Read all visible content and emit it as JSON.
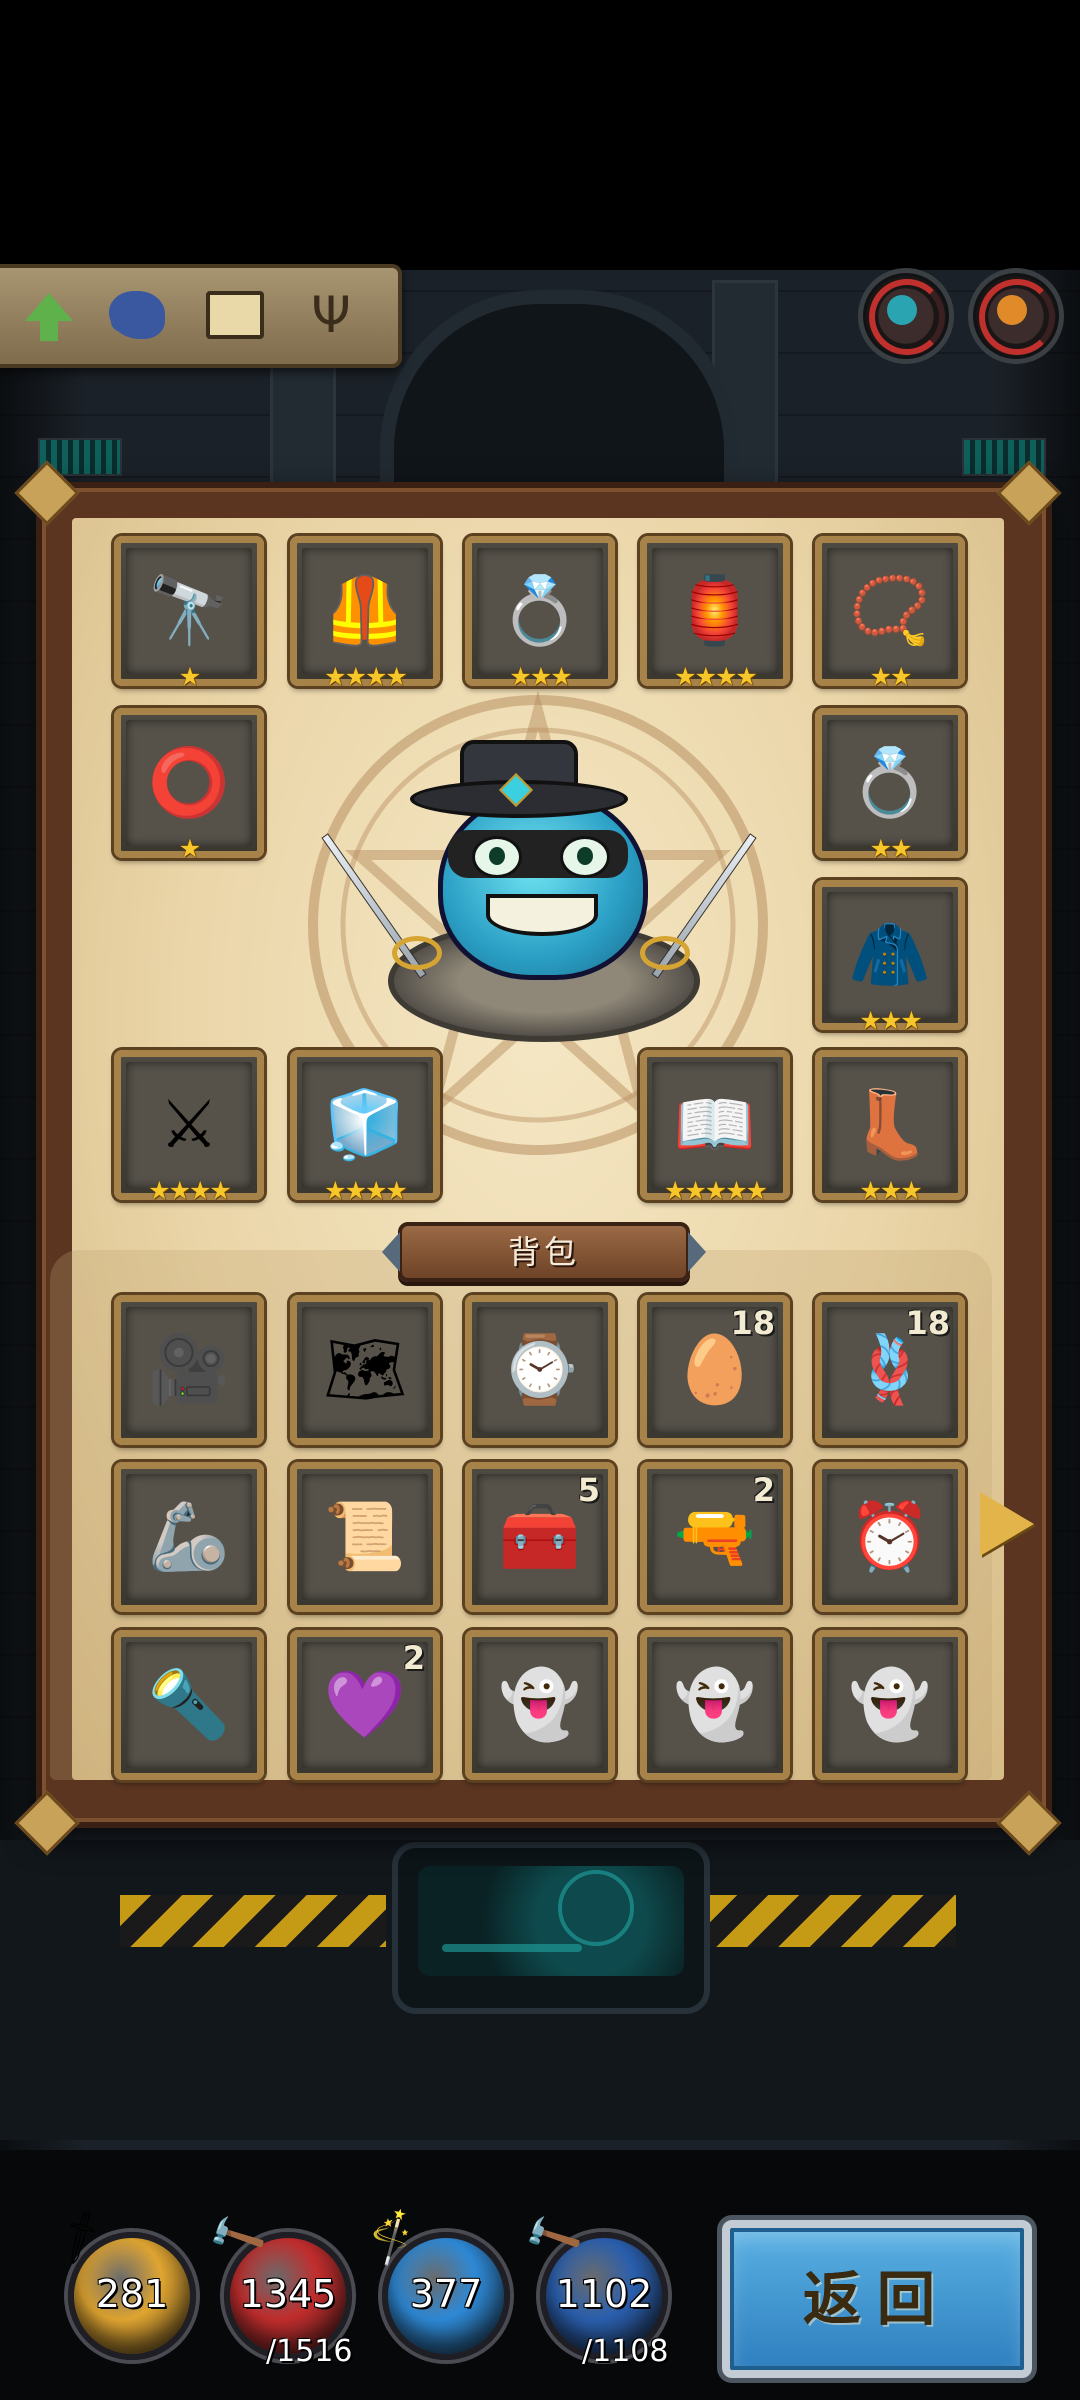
{
  "toolbar": {
    "buttons": [
      {
        "name": "upgrade",
        "icon": "green-up-arrow-icon"
      },
      {
        "name": "paint",
        "icon": "ink-splat-icon"
      },
      {
        "name": "luggage",
        "icon": "suitcase-icon"
      },
      {
        "name": "candelabra",
        "icon": "candelabra-icon"
      }
    ]
  },
  "equipment": [
    {
      "icon": "telescope-icon",
      "glyph": "🔭",
      "stars": "★"
    },
    {
      "icon": "armor-icon",
      "glyph": "🦺",
      "stars": "★★★★"
    },
    {
      "icon": "gold-ring-icon",
      "glyph": "💍",
      "stars": "★★★"
    },
    {
      "icon": "witch-hat-lamp-icon",
      "glyph": "🏮",
      "stars": "★★★★"
    },
    {
      "icon": "amulet-necklace-icon",
      "glyph": "📿",
      "stars": "★★"
    },
    {
      "icon": "silver-bracelet-icon",
      "glyph": "⭕",
      "stars": "★"
    },
    {
      "icon": "silver-ring-icon",
      "glyph": "💍",
      "stars": "★★"
    },
    {
      "icon": "fur-cloak-icon",
      "glyph": "🧥",
      "stars": "★★★"
    },
    {
      "icon": "crossed-swords-icon",
      "glyph": "⚔",
      "stars": "★★★★"
    },
    {
      "icon": "ice-block-icon",
      "glyph": "🧊",
      "stars": "★★★★"
    },
    {
      "icon": "skull-spellbook-icon",
      "glyph": "📖",
      "stars": "★★★★★"
    },
    {
      "icon": "mechanical-boots-icon",
      "glyph": "👢",
      "stars": "★★★"
    }
  ],
  "bag": {
    "title": "背包",
    "items": [
      {
        "icon": "film-camera-icon",
        "glyph": "🎥",
        "count": ""
      },
      {
        "icon": "treasure-map-icon",
        "glyph": "🗺",
        "count": ""
      },
      {
        "icon": "pocket-watch-icon",
        "glyph": "⌚",
        "count": ""
      },
      {
        "icon": "egg-icon",
        "glyph": "🥚",
        "count": "18"
      },
      {
        "icon": "purple-rope-icon",
        "glyph": "🪢",
        "count": "18"
      },
      {
        "icon": "robot-arm-icon",
        "glyph": "🦾",
        "count": ""
      },
      {
        "icon": "scroll-icon",
        "glyph": "📜",
        "count": ""
      },
      {
        "icon": "first-aid-kit-icon",
        "glyph": "🧰",
        "count": "5"
      },
      {
        "icon": "pistol-icon",
        "glyph": "🔫",
        "count": "2"
      },
      {
        "icon": "alarm-clock-icon",
        "glyph": "⏰",
        "count": ""
      },
      {
        "icon": "spyglass-icon",
        "glyph": "🔦",
        "count": ""
      },
      {
        "icon": "purple-heart-icon",
        "glyph": "💜",
        "count": "2"
      },
      {
        "icon": "ghost-icon",
        "glyph": "👻",
        "count": ""
      },
      {
        "icon": "small-ghost-icon",
        "glyph": "👻",
        "count": ""
      },
      {
        "icon": "angry-ghost-icon",
        "glyph": "👻",
        "count": ""
      }
    ]
  },
  "stats": [
    {
      "name": "attack",
      "icon": "sword-icon",
      "color": "#e0a531",
      "value": "281",
      "max": ""
    },
    {
      "name": "health",
      "icon": "hammer-icon",
      "color": "#c22d2d",
      "value": "1345",
      "max": "/1516"
    },
    {
      "name": "magic",
      "icon": "wand-icon",
      "color": "#2e89d6",
      "value": "377",
      "max": ""
    },
    {
      "name": "mana",
      "icon": "staff-icon",
      "color": "#2a5fae",
      "value": "1102",
      "max": "/1108"
    }
  ],
  "return_label": "返回"
}
